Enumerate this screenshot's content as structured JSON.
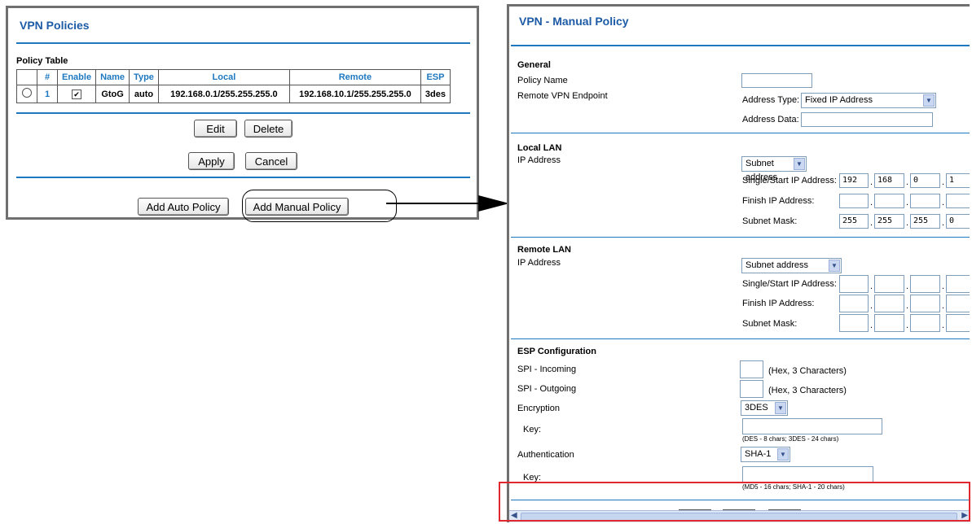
{
  "vpn_policies": {
    "title": "VPN Policies",
    "policy_table_label": "Policy Table",
    "columns": [
      "",
      "#",
      "Enable",
      "Name",
      "Type",
      "Local",
      "Remote",
      "ESP"
    ],
    "rows": [
      {
        "num": "1",
        "name": "GtoG",
        "type": "auto",
        "local": "192.168.0.1/255.255.255.0",
        "remote": "192.168.10.1/255.255.255.0",
        "esp": "3des",
        "enabled": true
      }
    ],
    "edit_label": "Edit",
    "delete_label": "Delete",
    "apply_label": "Apply",
    "cancel_label": "Cancel",
    "add_auto_label": "Add Auto Policy",
    "add_manual_label": "Add Manual Policy"
  },
  "manual_policy": {
    "title": "VPN - Manual Policy",
    "general": {
      "section": "General",
      "policy_name_label": "Policy Name",
      "policy_name_value": "",
      "remote_endpoint_label": "Remote VPN Endpoint",
      "address_type_label": "Address Type:",
      "address_type_value": "Fixed IP Address",
      "address_data_label": "Address Data:",
      "address_data_value": ""
    },
    "local_lan": {
      "section": "Local LAN",
      "ip_address_label": "IP Address",
      "ip_type_value": "Subnet address",
      "start_ip_label": "Single/Start IP Address:",
      "start_ip": [
        "192",
        "168",
        "0",
        "1"
      ],
      "finish_ip_label": "Finish IP Address:",
      "finish_ip": [
        "",
        "",
        "",
        ""
      ],
      "subnet_mask_label": "Subnet Mask:",
      "subnet_mask": [
        "255",
        "255",
        "255",
        "0"
      ]
    },
    "remote_lan": {
      "section": "Remote LAN",
      "ip_address_label": "IP Address",
      "ip_type_value": "Subnet address",
      "start_ip_label": "Single/Start IP Address:",
      "finish_ip_label": "Finish IP Address:",
      "subnet_mask_label": "Subnet Mask:"
    },
    "esp": {
      "section": "ESP Configuration",
      "spi_in_label": "SPI - Incoming",
      "spi_out_label": "SPI - Outgoing",
      "spi_hint": "(Hex, 3 Characters)",
      "encryption_label": "Encryption",
      "encryption_value": "3DES",
      "enc_key_label": "Key:",
      "enc_key_hint": "(DES - 8 chars;   3DES - 24 chars)",
      "auth_label": "Authentication",
      "auth_value": "SHA-1",
      "auth_key_label": "Key:",
      "auth_key_hint": "(MD5 - 16 chars;   SHA-1 - 20 chars)"
    }
  },
  "icons": {
    "dropdown": "chevron-down-icon",
    "scroll_left": "arrow-left-icon",
    "scroll_right": "arrow-right-icon",
    "callout_arrow": "arrow-right-icon"
  },
  "colors": {
    "title_blue": "#1d5ba6",
    "rule_blue": "#1d78c0",
    "highlight_red": "#e0282e"
  }
}
